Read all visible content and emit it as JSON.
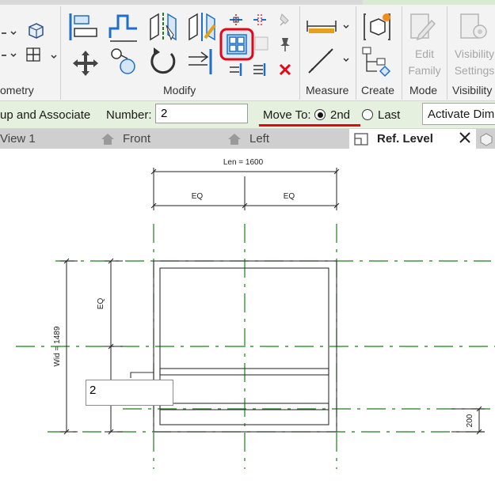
{
  "ribbon": {
    "panels": {
      "geometry": "ometry",
      "modify": "Modify",
      "measure": "Measure",
      "create": "Create",
      "mode": "Mode",
      "visibility": "Visibility"
    },
    "edit_family": [
      "Edit",
      "Family"
    ],
    "visibility_settings": [
      "Visibility",
      "Settings"
    ]
  },
  "options_bar": {
    "group_label": "up and Associate",
    "number_label": "Number:",
    "number_value": "2",
    "move_to_label": "Move To:",
    "option_2nd": "2nd",
    "option_last": "Last",
    "selected": "2nd",
    "activate_button": "Activate Dim"
  },
  "tabs": [
    {
      "label": "View 1"
    },
    {
      "label": "Front"
    },
    {
      "label": "Left"
    },
    {
      "label": "Ref. Level",
      "active": true
    }
  ],
  "drawing": {
    "dim_len": "Len = 1600",
    "dim_eq_left": "EQ",
    "dim_eq_right": "EQ",
    "dim_eq_vertical": "EQ",
    "dim_wid": "Wid = 1489",
    "dim_200": "200",
    "array_value": "2"
  },
  "colors": {
    "highlight": "#e30613",
    "refplane": "#1a7f1a",
    "ribbon_bg": "#f3f3f3",
    "options_bg": "#e6f0de",
    "icon_blue": "#1e6fc9"
  }
}
